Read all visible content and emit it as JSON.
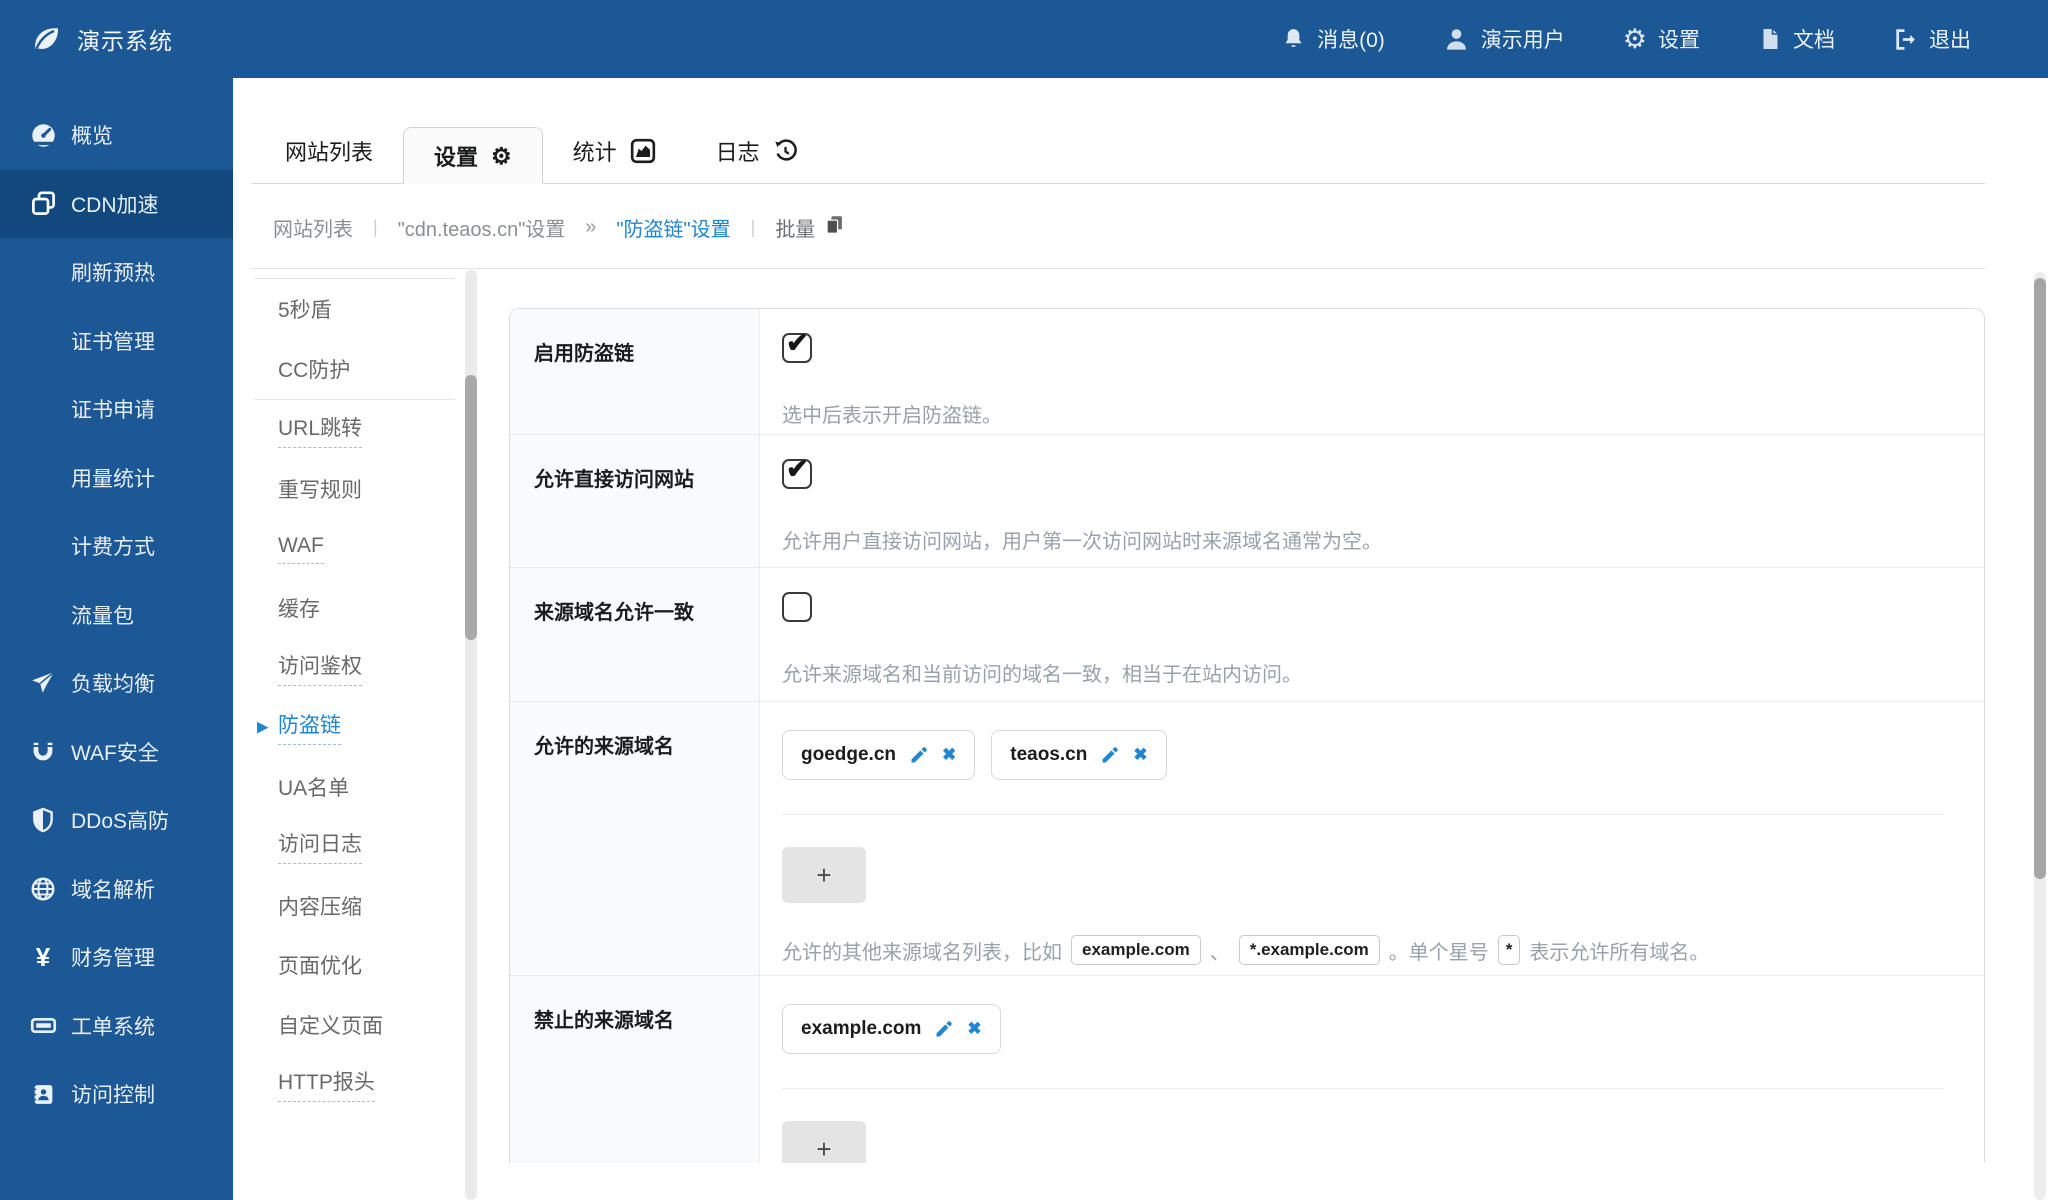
{
  "topbar": {
    "brand": "演示系统",
    "items": [
      {
        "id": "messages",
        "label": "消息(0)"
      },
      {
        "id": "user",
        "label": "演示用户"
      },
      {
        "id": "settings",
        "label": "设置"
      },
      {
        "id": "docs",
        "label": "文档"
      },
      {
        "id": "logout",
        "label": "退出"
      }
    ]
  },
  "sidebar": {
    "items": [
      {
        "label": "概览",
        "icon": "gauge-icon"
      },
      {
        "label": "CDN加速",
        "icon": "clone-icon",
        "active": true
      },
      {
        "label": "刷新预热"
      },
      {
        "label": "证书管理"
      },
      {
        "label": "证书申请"
      },
      {
        "label": "用量统计"
      },
      {
        "label": "计费方式"
      },
      {
        "label": "流量包"
      },
      {
        "label": "负载均衡",
        "icon": "paper-plane-icon"
      },
      {
        "label": "WAF安全",
        "icon": "magnet-icon"
      },
      {
        "label": "DDoS高防",
        "icon": "shield-icon"
      },
      {
        "label": "域名解析",
        "icon": "globe-icon"
      },
      {
        "label": "财务管理",
        "icon": "yen-icon"
      },
      {
        "label": "工单系统",
        "icon": "ticket-icon"
      },
      {
        "label": "访问控制",
        "icon": "id-card-icon"
      }
    ]
  },
  "tabs": {
    "items": [
      {
        "label": "网站列表"
      },
      {
        "label": "设置",
        "icon": "gear-icon",
        "active": true
      },
      {
        "label": "统计",
        "icon": "area-chart-icon"
      },
      {
        "label": "日志",
        "icon": "history-icon"
      }
    ]
  },
  "breadcrumb": {
    "items": [
      {
        "label": "网站列表"
      },
      {
        "label": "\"cdn.teaos.cn\"设置"
      },
      {
        "label": "\"防盗链\"设置",
        "active": true
      },
      {
        "label": "批量",
        "icon": "copy-icon"
      }
    ]
  },
  "subnav": {
    "groups": [
      {
        "items": [
          {
            "label": "5秒盾"
          },
          {
            "label": "CC防护"
          }
        ]
      },
      {
        "items": [
          {
            "label": "URL跳转",
            "dashed": true
          },
          {
            "label": "重写规则"
          },
          {
            "label": "WAF",
            "dashed": true
          },
          {
            "label": "缓存"
          },
          {
            "label": "访问鉴权",
            "dashed": true
          },
          {
            "label": "防盗链",
            "dashed": true,
            "active": true
          },
          {
            "label": "UA名单"
          },
          {
            "label": "访问日志",
            "dashed": true
          },
          {
            "label": "内容压缩"
          },
          {
            "label": "页面优化"
          },
          {
            "label": "自定义页面"
          },
          {
            "label": "HTTP报头",
            "dashed": true
          }
        ]
      }
    ]
  },
  "form": {
    "rows": [
      {
        "label": "启用防盗链",
        "type": "checkbox",
        "checked": true,
        "hint": "选中后表示开启防盗链。"
      },
      {
        "label": "允许直接访问网站",
        "type": "checkbox",
        "checked": true,
        "hint": "允许用户直接访问网站，用户第一次访问网站时来源域名通常为空。"
      },
      {
        "label": "来源域名允许一致",
        "type": "checkbox",
        "checked": false,
        "hint": "允许来源域名和当前访问的域名一致，相当于在站内访问。"
      },
      {
        "label": "允许的来源域名",
        "type": "tags",
        "tags": [
          "goedge.cn",
          "teaos.cn"
        ],
        "hint": {
          "pre": "允许的其他来源域名列表，比如",
          "c1": "example.com",
          "s1": "、",
          "c2": "*.example.com",
          "s2": "。单个星号",
          "c3": "*",
          "post": "表示允许所有域名。"
        }
      },
      {
        "label": "禁止的来源域名",
        "type": "tags",
        "tags": [
          "example.com"
        ]
      }
    ]
  },
  "glyphs": {
    "check": "✔",
    "close": "✖",
    "gear": "⚙",
    "plus": "+",
    "arrow": "▶",
    "pipe": "|",
    "guillemet": "»",
    "yen": "¥"
  },
  "colors": {
    "primary_blue": "#1c5796",
    "active_blue": "#11497f",
    "link_blue": "#2185d0",
    "hint_gray": "#98a2ab"
  }
}
